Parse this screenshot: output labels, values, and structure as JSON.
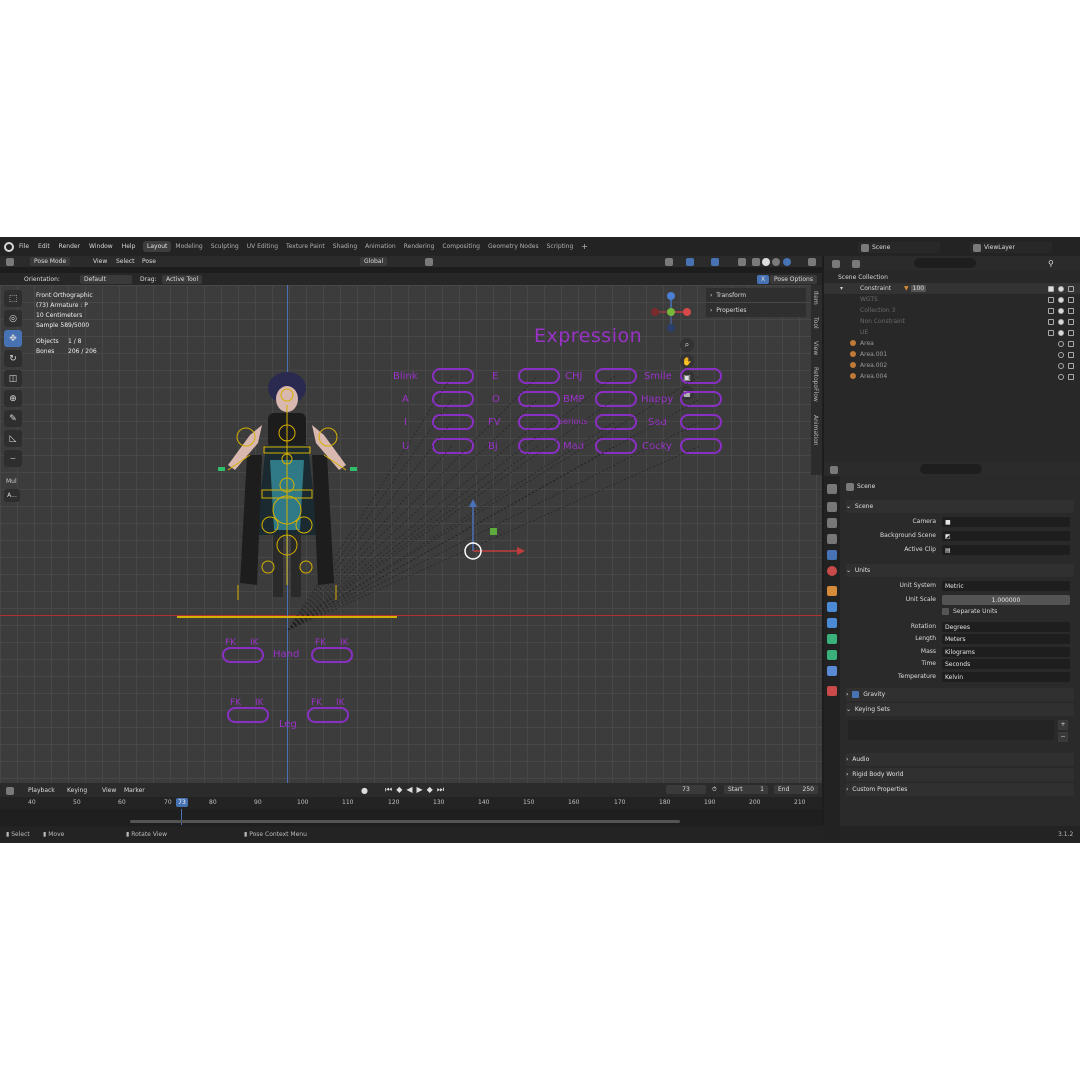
{
  "topbar": {
    "menus": [
      "File",
      "Edit",
      "Render",
      "Window",
      "Help"
    ],
    "workspaces": [
      "Layout",
      "Modeling",
      "Sculpting",
      "UV Editing",
      "Texture Paint",
      "Shading",
      "Animation",
      "Rendering",
      "Compositing",
      "Geometry Nodes",
      "Scripting"
    ],
    "active_workspace": "Layout",
    "add_tab": "+",
    "scene": "Scene",
    "view_layer": "ViewLayer"
  },
  "viewport_header": {
    "mode": "Pose Mode",
    "menus": [
      "View",
      "Select",
      "Pose"
    ],
    "transform_orientation": "Global",
    "orientation_label": "Orientation:",
    "orientation_value": "Default",
    "drag_label": "Drag:",
    "drag_value": "Active Tool",
    "pose_options": "Pose Options",
    "x_button": "X"
  },
  "viewport": {
    "view_name": "Front Orthographic",
    "active_object": "(73) Armature : P",
    "grid_scale": "10 Centimeters",
    "sample": "Sample 589/5000",
    "objects_label": "Objects",
    "objects_value": "1 / 8",
    "bones_label": "Bones",
    "bones_value": "206 / 206",
    "side_tool_label": "Mul",
    "side_tool_button": "A...",
    "n_tabs": [
      "Item",
      "Tool",
      "View",
      "RetopoFlow",
      "Animation"
    ],
    "n_panel": [
      "Transform",
      "Properties"
    ],
    "expression_title": "Expression",
    "expression_labels": [
      [
        "Blink",
        "A",
        "I",
        "U"
      ],
      [
        "E",
        "O",
        "FV",
        "Bj"
      ],
      [
        "CHJ",
        "BMP",
        "Serious",
        "Mad"
      ],
      [
        "Smile",
        "Happy",
        "Sad",
        "Cocky"
      ]
    ],
    "hand_label": "Hand",
    "leg_label": "Leg",
    "fk": "FK",
    "ik": "IK"
  },
  "timeline": {
    "menus": [
      "Playback",
      "Keying",
      "View",
      "Marker"
    ],
    "current_frame": "73",
    "start_label": "Start",
    "start": "1",
    "end_label": "End",
    "end": "250",
    "ticks": [
      "40",
      "50",
      "60",
      "70",
      "80",
      "90",
      "100",
      "110",
      "120",
      "130",
      "140",
      "150",
      "160",
      "170",
      "180",
      "190",
      "200",
      "210"
    ],
    "playhead": "73"
  },
  "statusbar": {
    "items": [
      "Select",
      "Move",
      "Rotate View",
      "Pose Context Menu"
    ],
    "version": "3.1.2"
  },
  "outliner": {
    "search_placeholder": "",
    "rows": [
      {
        "name": "Scene Collection",
        "level": 0
      },
      {
        "name": "Constraint",
        "level": 1,
        "badge": "100"
      },
      {
        "name": "WGTS",
        "level": 2
      },
      {
        "name": "Collection 3",
        "level": 2
      },
      {
        "name": "Non Constraint",
        "level": 2
      },
      {
        "name": "UE",
        "level": 2
      },
      {
        "name": "Area",
        "level": 1
      },
      {
        "name": "Area.001",
        "level": 1
      },
      {
        "name": "Area.002",
        "level": 1
      },
      {
        "name": "Area.004",
        "level": 1
      }
    ]
  },
  "properties": {
    "context": "Scene",
    "scene_section": "Scene",
    "camera_label": "Camera",
    "background_scene_label": "Background Scene",
    "active_clip_label": "Active Clip",
    "units_section": "Units",
    "unit_system_label": "Unit System",
    "unit_system": "Metric",
    "unit_scale_label": "Unit Scale",
    "unit_scale": "1.000000",
    "separate_units": "Separate Units",
    "rotation_label": "Rotation",
    "rotation": "Degrees",
    "length_label": "Length",
    "length": "Meters",
    "mass_label": "Mass",
    "mass": "Kilograms",
    "time_label": "Time",
    "time": "Seconds",
    "temperature_label": "Temperature",
    "temperature": "Kelvin",
    "gravity": "Gravity",
    "keying_sets": "Keying Sets",
    "audio": "Audio",
    "rigid_body_world": "Rigid Body World",
    "custom_properties": "Custom Properties"
  },
  "colors": {
    "accent": "#4772b3",
    "rig_purple": "#9a32c8",
    "bone_yellow": "#d6b000",
    "x_axis": "#b03030",
    "z_axis": "#4b72b8"
  }
}
